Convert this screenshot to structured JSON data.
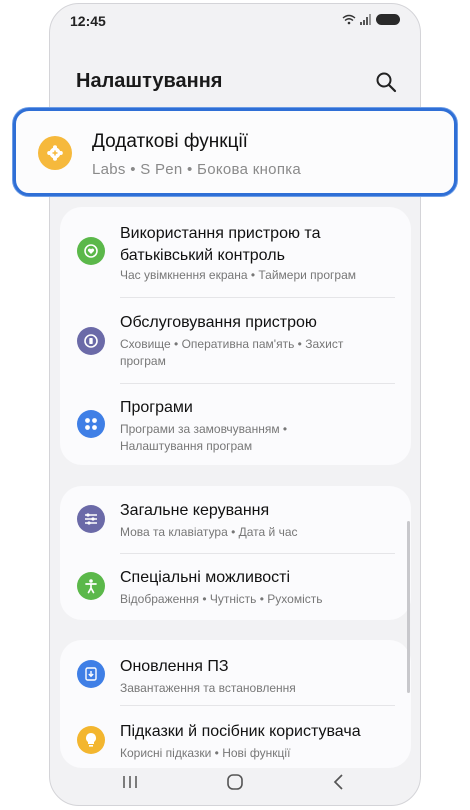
{
  "status": {
    "time": "12:45"
  },
  "header": {
    "title": "Налаштування"
  },
  "highlight": {
    "title": "Додаткові функції",
    "subtitle": "Labs  •  S Pen  •  Бокова кнопка"
  },
  "group1": [
    {
      "title": "Використання пристрою та батьківський контроль",
      "subtitle": "Час увімкнення екрана  •  Таймери програм"
    },
    {
      "title": "Обслуговування пристрою",
      "subtitle": "Сховище  •  Оперативна пам'ять  •  Захист програм"
    },
    {
      "title": "Програми",
      "subtitle": "Програми за замовчуванням  •  Налаштування програм"
    }
  ],
  "group2": [
    {
      "title": "Загальне керування",
      "subtitle": "Мова та клавіатура  •  Дата й час"
    },
    {
      "title": "Спеціальні можливості",
      "subtitle": "Відображення  •  Чутність  •  Рухомість"
    }
  ],
  "group3": [
    {
      "title": "Оновлення ПЗ",
      "subtitle": "Завантаження та встановлення"
    },
    {
      "title": "Підказки й посібник користувача",
      "subtitle": "Корисні підказки  •  Нові функції"
    }
  ],
  "colors": {
    "highlight_border": "#2f6fd6",
    "advanced_icon": "#f6b93c",
    "wellbeing_icon": "#5bb84a",
    "care_icon": "#6b6aa8",
    "apps_icon": "#3f7fe6",
    "general_icon": "#6b6aa8",
    "accessibility_icon": "#5bb84a",
    "update_icon": "#3f7fe6",
    "tips_icon": "#f3b62f"
  }
}
